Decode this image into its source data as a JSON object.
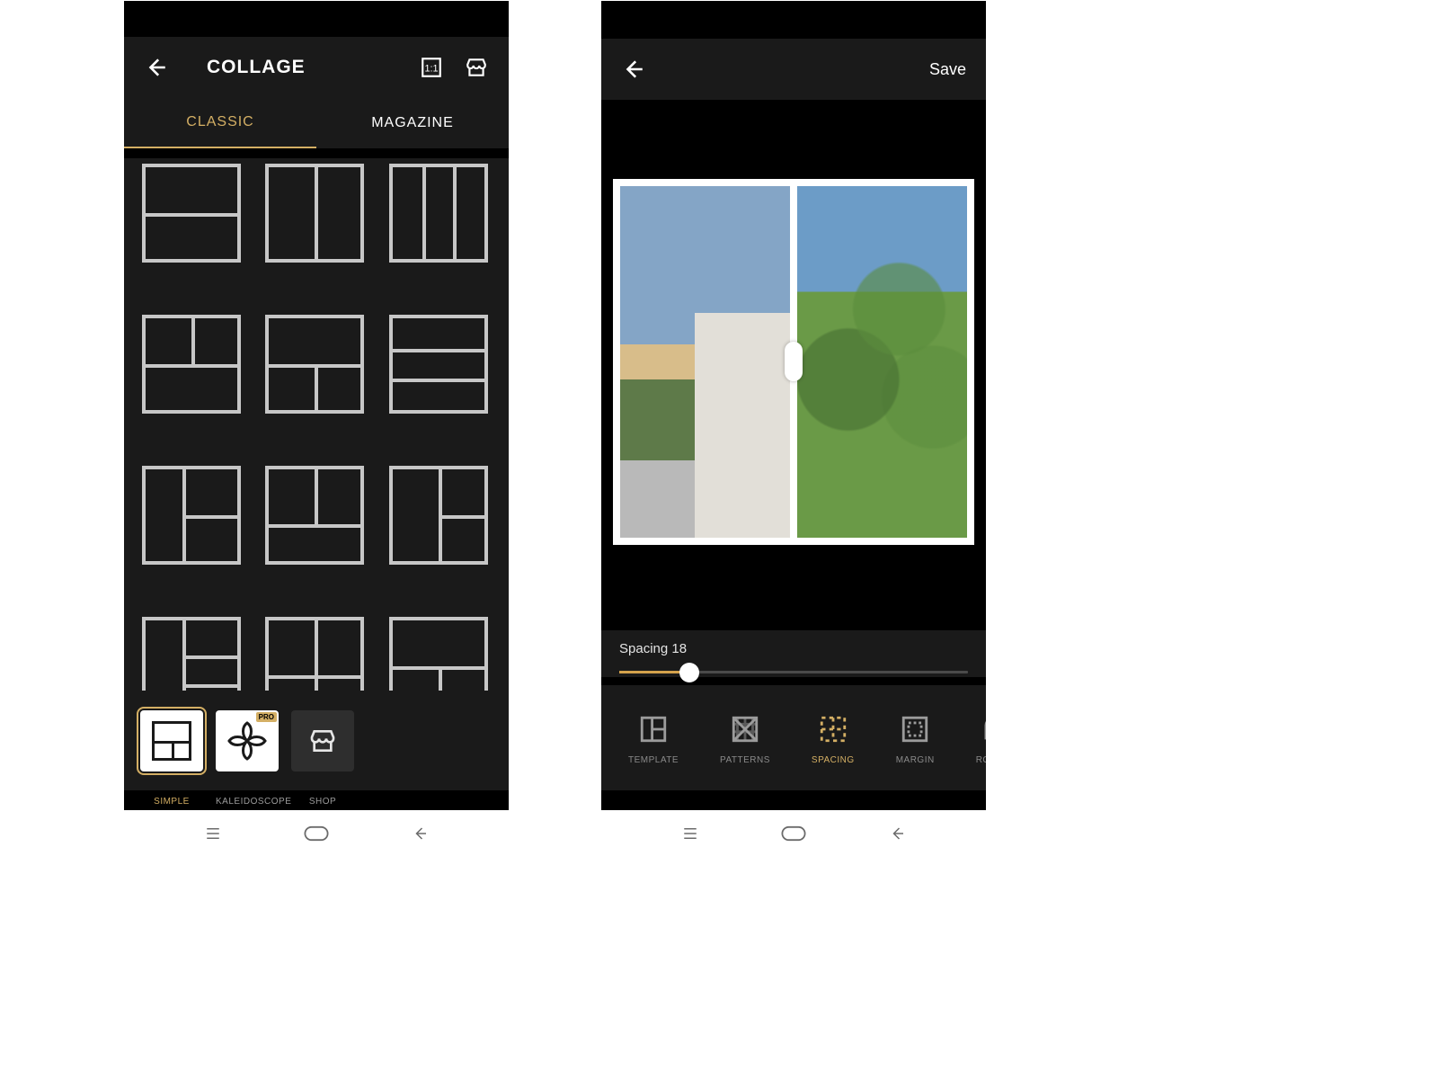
{
  "left": {
    "header": {
      "title": "COLLAGE"
    },
    "tabs": {
      "classic": "CLASSIC",
      "magazine": "MAGAZINE",
      "active": "classic"
    },
    "toolbar": {
      "items": [
        {
          "id": "simple",
          "label": "SIMPLE",
          "active": true
        },
        {
          "id": "kaleidoscope",
          "label": "KALEIDOSCOPE",
          "active": false,
          "pro": true
        },
        {
          "id": "shop",
          "label": "SHOP",
          "active": false
        }
      ],
      "pro_badge": "PRO"
    }
  },
  "right": {
    "header": {
      "save": "Save"
    },
    "spacing": {
      "label_prefix": "Spacing ",
      "value": 18,
      "min": 0,
      "max": 100
    },
    "tools": [
      {
        "id": "template",
        "label": "TEMPLATE",
        "active": false
      },
      {
        "id": "patterns",
        "label": "PATTERNS",
        "active": false
      },
      {
        "id": "spacing",
        "label": "SPACING",
        "active": true
      },
      {
        "id": "margin",
        "label": "MARGIN",
        "active": false
      },
      {
        "id": "roundn",
        "label": "ROUNDN",
        "active": false
      }
    ]
  }
}
